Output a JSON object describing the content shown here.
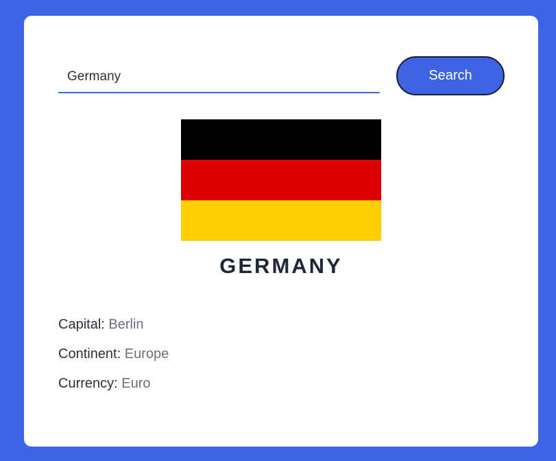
{
  "search": {
    "value": "Germany",
    "button_label": "Search"
  },
  "flag": {
    "stripe_colors": [
      "#000000",
      "#dd0000",
      "#ffce00"
    ]
  },
  "country": {
    "name": "GERMANY",
    "details": [
      {
        "label": "Capital:",
        "value": "Berlin"
      },
      {
        "label": "Continent:",
        "value": "Europe"
      },
      {
        "label": "Currency:",
        "value": "Euro"
      }
    ]
  },
  "colors": {
    "background": "#3d64e4",
    "accent": "#3d64e4",
    "card": "#ffffff"
  }
}
